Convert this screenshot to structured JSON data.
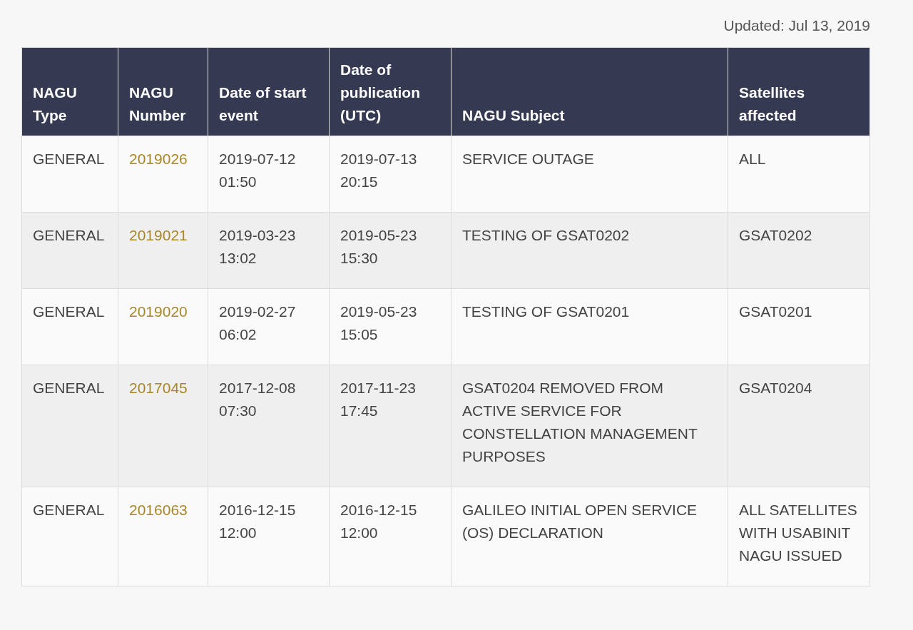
{
  "updated": "Updated: Jul 13, 2019",
  "table": {
    "columns": [
      "NAGU Type",
      "NAGU Number",
      "Date of start event",
      "Date of publication (UTC)",
      "NAGU Subject",
      "Satellites affected"
    ],
    "rows": [
      {
        "type": "GENERAL",
        "number": "2019026",
        "start": "2019-07-12 01:50",
        "published": "2019-07-13 20:15",
        "subject": "SERVICE OUTAGE",
        "satellites": "ALL"
      },
      {
        "type": "GENERAL",
        "number": "2019021",
        "start": "2019-03-23 13:02",
        "published": "2019-05-23 15:30",
        "subject": "TESTING OF GSAT0202",
        "satellites": "GSAT0202"
      },
      {
        "type": "GENERAL",
        "number": "2019020",
        "start": "2019-02-27 06:02",
        "published": "2019-05-23 15:05",
        "subject": "TESTING OF GSAT0201",
        "satellites": "GSAT0201"
      },
      {
        "type": "GENERAL",
        "number": "2017045",
        "start": "2017-12-08 07:30",
        "published": "2017-11-23 17:45",
        "subject": "GSAT0204 REMOVED FROM ACTIVE SERVICE FOR CONSTELLATION MANAGEMENT PURPOSES",
        "satellites": "GSAT0204"
      },
      {
        "type": "GENERAL",
        "number": "2016063",
        "start": "2016-12-15 12:00",
        "published": "2016-12-15 12:00",
        "subject": "GALILEO INITIAL OPEN SERVICE (OS) DECLARATION",
        "satellites": "ALL SATELLITES WITH USABINIT NAGU ISSUED"
      }
    ]
  }
}
